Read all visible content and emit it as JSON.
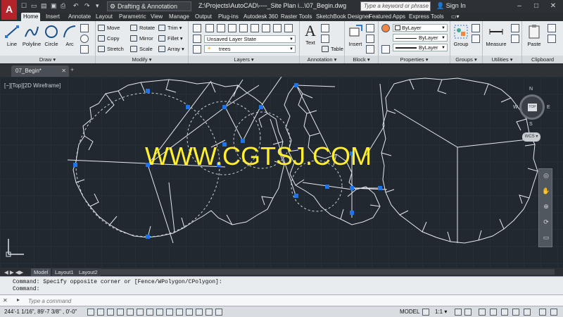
{
  "app": {
    "logo_letter": "A",
    "quick_access": [
      "☐",
      "▭",
      "▤",
      "▣",
      "⎙",
      "↶",
      "↷",
      "▾"
    ],
    "workspace": "Drafting & Annotation",
    "file_title": "Z:\\Projects\\AutoCAD\\----_Site Plan i...\\07_Begin.dwg",
    "search_placeholder": "Type a keyword or phrase",
    "signin": "Sign In",
    "window_buttons": [
      "–",
      "□",
      "✕"
    ]
  },
  "tabs": [
    "Home",
    "Insert",
    "Annotate",
    "Layout",
    "Parametric",
    "View",
    "Manage",
    "Output",
    "Plug-ins",
    "Autodesk 360",
    "Raster Tools",
    "SketchBook Designer",
    "Featured Apps",
    "Express Tools",
    "▭▾"
  ],
  "ribbon": {
    "draw": {
      "title": "Draw ▾",
      "line": "Line",
      "polyline": "Polyline",
      "circle": "Circle",
      "arc": "Arc"
    },
    "modify": {
      "title": "Modify ▾",
      "move": "Move",
      "rotate": "Rotate",
      "trim": "Trim ▾",
      "copy": "Copy",
      "mirror": "Mirror",
      "fillet": "Fillet ▾",
      "stretch": "Stretch",
      "scale": "Scale",
      "array": "Array ▾"
    },
    "layers": {
      "title": "Layers ▾",
      "layer_state": "Unsaved Layer State",
      "current_layer": "trees"
    },
    "annotation": {
      "title": "Annotation ▾",
      "text": "Text",
      "table": "Table"
    },
    "block": {
      "title": "Block ▾",
      "insert": "Insert"
    },
    "properties": {
      "title": "Properties ▾",
      "color": "ByLayer",
      "linetype": "ByLayer",
      "lineweight": "ByLayer"
    },
    "groups": {
      "title": "Groups ▾",
      "group": "Group"
    },
    "utilities": {
      "title": "Utilities ▾",
      "measure": "Measure"
    },
    "clipboard": {
      "title": "Clipboard",
      "paste": "Paste"
    }
  },
  "document_tab": {
    "name": "07_Begin*",
    "close": "✕"
  },
  "viewport": {
    "label": "[−][Top][2D Wireframe]",
    "watermark": "WWW.CGTSJ.COM",
    "viewcube": {
      "face": "TOP",
      "n": "N",
      "s": "S",
      "e": "E",
      "w": "W",
      "wcs": "WCS ▾"
    }
  },
  "layout_tabs": [
    "Model",
    "Layout1",
    "Layout2"
  ],
  "command": {
    "history": [
      "Command: Specify opposite corner or [Fence/WPolygon/CPolygon]:",
      "Command:"
    ],
    "input_placeholder": "Type a command"
  },
  "status": {
    "coords": "244'-1 1/16\", 89'-7 3/8\" , 0'-0\"",
    "model": "MODEL",
    "scale": "1:1 ▾"
  },
  "colors": {
    "canvas": "#212830",
    "grip": "#1e74e8",
    "watermark": "#ffef2e",
    "logo": "#b3232a"
  }
}
